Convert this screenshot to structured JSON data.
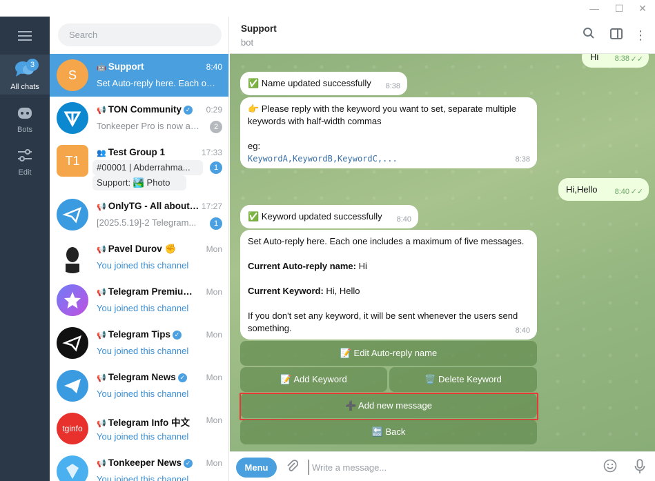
{
  "rail": {
    "all_chats_label": "All chats",
    "all_chats_badge": "3",
    "bots_label": "Bots",
    "edit_label": "Edit"
  },
  "search": {
    "placeholder": "Search"
  },
  "chats": [
    {
      "name": "Support",
      "time": "8:40",
      "preview": "Set Auto-reply here. Each one includes a maximum of five messages.",
      "avatar": "S",
      "avatar_color": "#f5a64b"
    },
    {
      "name": "TON Community",
      "time": "0:29",
      "preview": "Tonkeeper Pro is now available",
      "badge": "2",
      "avatar_color": "#0b88d0"
    },
    {
      "name": "Test Group 1",
      "time": "17:33",
      "preview": "#00001 | Abderrahma...",
      "preview2": "Support: 🏞️ Photo",
      "badge": "1",
      "avatar": "T1",
      "avatar_color": "#f5a64b"
    },
    {
      "name": "OnlyTG - All about T...",
      "time": "17:27",
      "preview": "[2025.5.19]-2 Telegram...",
      "badge": "1",
      "avatar_color": "#3a9be0"
    },
    {
      "name": "Pavel Durov ✊",
      "time": "Mon",
      "preview": "You joined this channel",
      "avatar_color": "#222"
    },
    {
      "name": "Telegram Premium",
      "time": "Mon",
      "preview": "You joined this channel",
      "avatar_color": "#8e5cf0"
    },
    {
      "name": "Telegram Tips",
      "time": "Mon",
      "preview": "You joined this channel",
      "avatar_color": "#111"
    },
    {
      "name": "Telegram News",
      "time": "Mon",
      "preview": "You joined this channel",
      "avatar_color": "#3a9be0"
    },
    {
      "name": "Telegram Info 中文",
      "time": "Mon",
      "preview": "You joined this channel",
      "avatar": "tginfo",
      "avatar_color": "#e8302c"
    },
    {
      "name": "Tonkeeper News",
      "time": "Mon",
      "preview": "You joined this channel",
      "avatar_color": "#4ab0f0"
    }
  ],
  "header": {
    "title": "Support",
    "subtitle": "bot"
  },
  "messages": {
    "m0": {
      "text": "Hi",
      "time": "8:38"
    },
    "m1": {
      "text": "✅ Name updated successfully",
      "time": "8:38"
    },
    "m2": {
      "line1": "👉 Please reply with the keyword you want to set, separate multiple keywords with half-width commas",
      "line2": "eg:",
      "line3": "KeywordA,KeywordB,KeywordC,...",
      "time": "8:38"
    },
    "m3": {
      "text": "Hi,Hello",
      "time": "8:40"
    },
    "m4": {
      "text": "✅ Keyword updated successfully",
      "time": "8:40"
    },
    "m5": {
      "line1": "Set Auto-reply here. Each one includes a maximum of five messages.",
      "name_label": "Current Auto-reply name:",
      "name_value": " Hi",
      "kw_label": "Current Keyword:",
      "kw_value": " Hi, Hello",
      "line4": "If you don't set any keyword, it will be sent whenever the users send something.",
      "time": "8:40"
    }
  },
  "keyboard": {
    "edit_name": "📝 Edit Auto-reply name",
    "add_keyword": "📝 Add Keyword",
    "delete_keyword": "🗑️ Delete Keyword",
    "add_message": "➕ Add new message",
    "back": "🔙 Back"
  },
  "composer": {
    "menu_label": "Menu",
    "placeholder": "Write a message..."
  }
}
